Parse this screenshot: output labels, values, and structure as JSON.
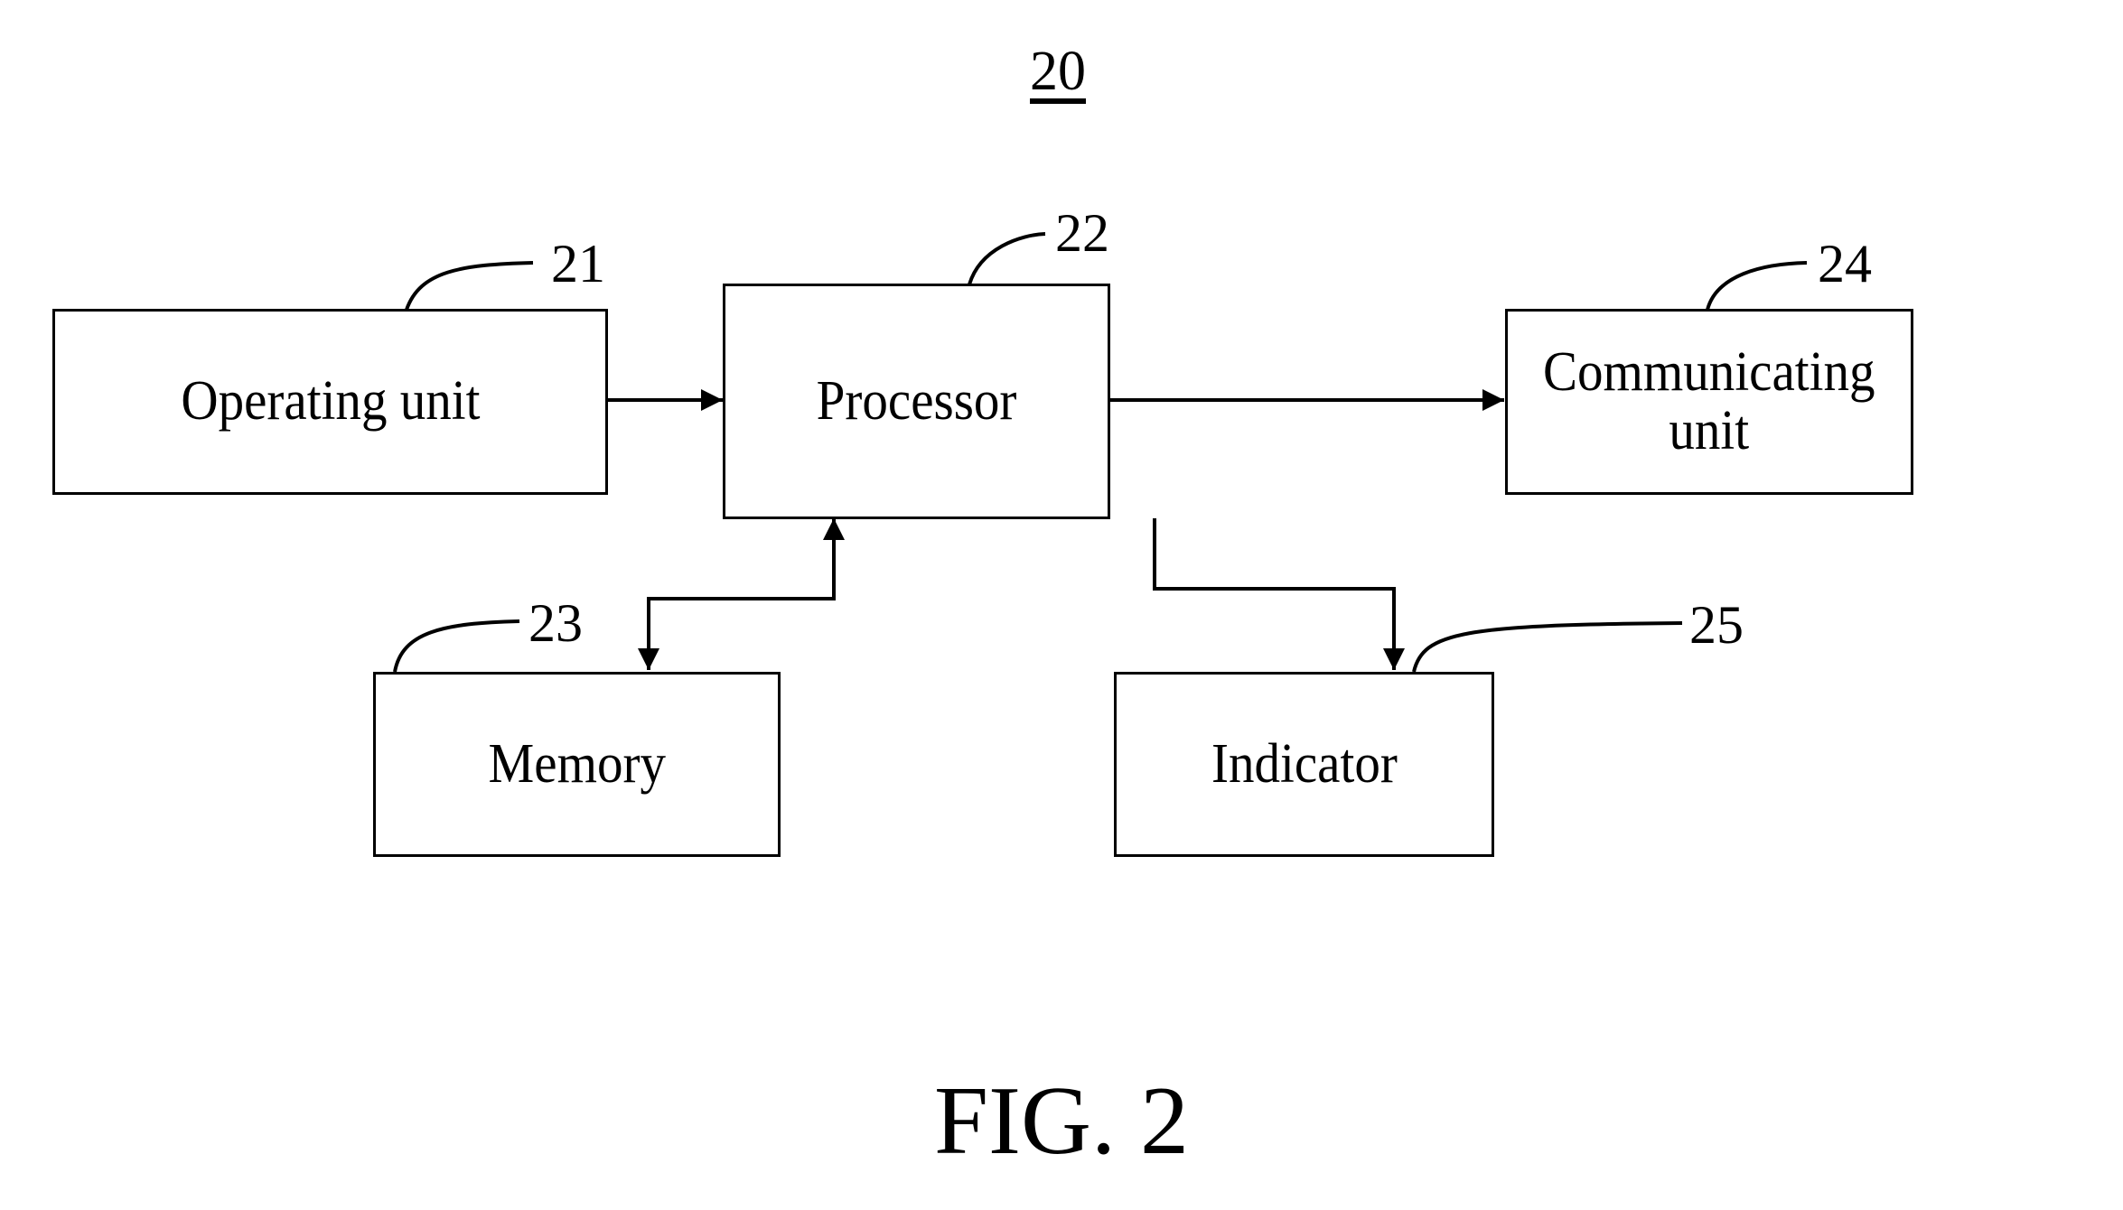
{
  "figure": {
    "number": "20",
    "caption": "FIG. 2"
  },
  "blocks": {
    "operating_unit": {
      "label": "Operating unit",
      "ref": "21"
    },
    "processor": {
      "label": "Processor",
      "ref": "22"
    },
    "memory": {
      "label": "Memory",
      "ref": "23"
    },
    "communicating_unit": {
      "label": "Communicating\nunit",
      "ref": "24"
    },
    "indicator": {
      "label": "Indicator",
      "ref": "25"
    }
  },
  "connections": [
    {
      "from": "operating_unit",
      "to": "processor",
      "direction": "one-way"
    },
    {
      "from": "processor",
      "to": "communicating_unit",
      "direction": "one-way"
    },
    {
      "from": "processor",
      "to": "memory",
      "direction": "two-way"
    },
    {
      "from": "processor",
      "to": "indicator",
      "direction": "one-way"
    }
  ],
  "colors": {
    "line": "#000000",
    "background": "#ffffff"
  }
}
